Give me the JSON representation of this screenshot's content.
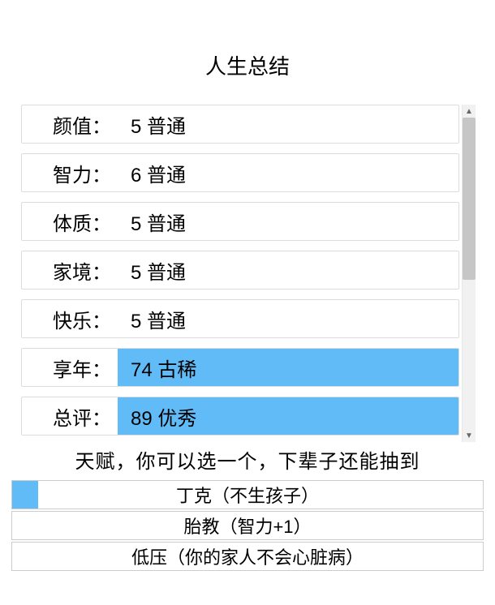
{
  "title": "人生总结",
  "stats": [
    {
      "label": "颜值：",
      "value": "5 普通",
      "highlight": false
    },
    {
      "label": "智力：",
      "value": "6 普通",
      "highlight": false
    },
    {
      "label": "体质：",
      "value": "5 普通",
      "highlight": false
    },
    {
      "label": "家境：",
      "value": "5 普通",
      "highlight": false
    },
    {
      "label": "快乐：",
      "value": "5 普通",
      "highlight": false
    },
    {
      "label": "享年：",
      "value": "74 古稀",
      "highlight": true
    },
    {
      "label": "总评：",
      "value": "89 优秀",
      "highlight": true
    }
  ],
  "talent_heading": "天赋，你可以选一个，下辈子还能抽到",
  "talents": [
    {
      "name": "丁克（不生孩子）",
      "selected": true
    },
    {
      "name": "胎教（智力+1）",
      "selected": false
    },
    {
      "name": "低压（你的家人不会心脏病）",
      "selected": false
    }
  ],
  "colors": {
    "highlight": "#61bbf7"
  }
}
